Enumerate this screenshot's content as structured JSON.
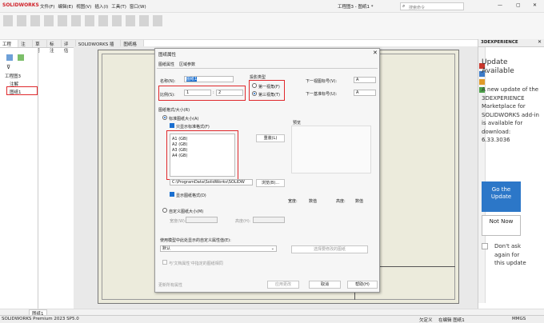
{
  "app": {
    "logo_text": "SOLIDWORKS",
    "menu": [
      "文件(F)",
      "编辑(E)",
      "视图(V)",
      "插入(I)",
      "工具(T)",
      "窗口(W)"
    ],
    "window_title": "工程图3 - 图纸1 *",
    "search_placeholder": "搜索命令"
  },
  "ribbon": {
    "tabs": [
      "工程图",
      "注解",
      "草图",
      "标注",
      "评估",
      "SOLIDWORKS 插件",
      "图纸格式"
    ]
  },
  "tree": {
    "root": "工程图3",
    "items": [
      "注解",
      "图纸1"
    ]
  },
  "dialog": {
    "title": "图纸属性",
    "tabs": [
      "图纸属性",
      "区域参数"
    ],
    "name_label": "名称(N):",
    "name_value": "图纸1",
    "scale_label": "比例(S):",
    "scale_a": "1",
    "scale_sep": ":",
    "scale_b": "2",
    "projection_label": "投影类型",
    "projection_first": "第一视角(F)",
    "projection_third": "第三视角(T)",
    "next_view_label": "下一视图标号(V):",
    "next_view_value": "A",
    "next_datum_label": "下一基准标号(U):",
    "next_datum_value": "A",
    "format_group": "图纸格式/大小(R)",
    "standard_size": "标准图纸大小(A)",
    "show_std_only": "只显示标准格式(F)",
    "sizes": [
      "A1 (GB)",
      "A2 (GB)",
      "A3 (GB)",
      "A4 (GB)"
    ],
    "reload_button": "重装(L)",
    "path_value": "C:\\ProgramData\\SolidWorks\\SOLIDW",
    "browse_button": "浏览(B)...",
    "preview_label": "预览",
    "show_format": "显示图纸格式(D)",
    "custom_size": "自定义图纸大小(M)",
    "width_label": "宽度(W):",
    "height_label": "高度(H):",
    "dims": {
      "w_label": "宽度:",
      "w_value": "数值",
      "h_label": "高度:",
      "h_value": "数值"
    },
    "custom_prop_label": "使用模型中此处显示的自定义属性值(E):",
    "custom_prop_value": "默认",
    "select_props_button": "选择要修改的图纸",
    "same_as_label": "与'文档属性'中指定的图纸相同",
    "update_all_button": "更新所有属性",
    "apply_button": "应用更改",
    "cancel_button": "取消",
    "help_button": "帮助(H)"
  },
  "right_panel": {
    "header": "3DEXPERIENCE",
    "title": "Update Available",
    "message": "A new update of the 3DEXPERIENCE Marketplace for SOLIDWORKS add-in is available for download: 6.33.3036",
    "go_button": "Go the Update",
    "not_now_button": "Not Now",
    "dont_ask": "Don't ask again for this update"
  },
  "bottom": {
    "sheet_tab": "图纸1",
    "status_left": "SOLIDWORKS Premium 2023 SP5.0",
    "status_right": [
      "欠定义",
      "在编辑 图纸1",
      "MMGS"
    ]
  },
  "colors": {
    "accent": "#1a6fd0",
    "highlight": "#e0282c",
    "go_button": "#2c77c8"
  }
}
